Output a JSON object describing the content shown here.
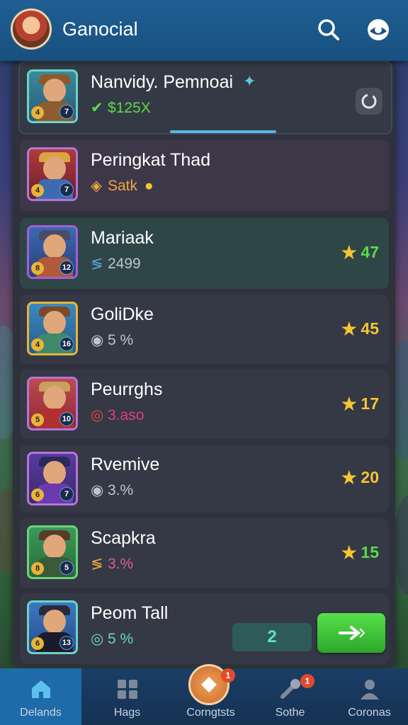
{
  "app": {
    "title": "Ganocial"
  },
  "colors": {
    "accent": "#1f6aa8",
    "green": "#5bd94b",
    "gold": "#f5c531"
  },
  "rows": [
    {
      "name": "Nanvidy. Pemnoai",
      "sub": "$125X",
      "sub_color": "#5bd94b",
      "left_badge": "4",
      "right_badge": "7",
      "score": ""
    },
    {
      "name": "Peringkat Thad",
      "sub": "Satk",
      "sub_color": "#f0a640",
      "left_badge": "4",
      "right_badge": "7",
      "score": ""
    },
    {
      "name": "Mariaak",
      "sub": "2499",
      "sub_color": "#b9c5d6",
      "left_badge": "8",
      "right_badge": "12",
      "score": "47"
    },
    {
      "name": "GoliDke",
      "sub": "5 %",
      "sub_color": "#b9c5d6",
      "left_badge": "4",
      "right_badge": "16",
      "score": "45"
    },
    {
      "name": "Peurrghs",
      "sub": "3.aso",
      "sub_color": "#e0407a",
      "left_badge": "5",
      "right_badge": "10",
      "score": "17"
    },
    {
      "name": "Rvemive",
      "sub": "3.%",
      "sub_color": "#b9c5d6",
      "left_badge": "6",
      "right_badge": "7",
      "score": "20"
    },
    {
      "name": "Scapkra",
      "sub": "3.%",
      "sub_color": "#e35aa0",
      "left_badge": "8",
      "right_badge": "5",
      "score": "15"
    },
    {
      "name": "Peom Tall",
      "sub": "5 %",
      "sub_color": "#6bd3c5",
      "left_badge": "6",
      "right_badge": "13",
      "score": ""
    }
  ],
  "last_row": {
    "counter": "2"
  },
  "nav": [
    {
      "label": "Delands"
    },
    {
      "label": "Hags"
    },
    {
      "label": "Corngtsts",
      "badge": "1"
    },
    {
      "label": "Sothe",
      "badge": "1"
    },
    {
      "label": "Coronas"
    }
  ]
}
